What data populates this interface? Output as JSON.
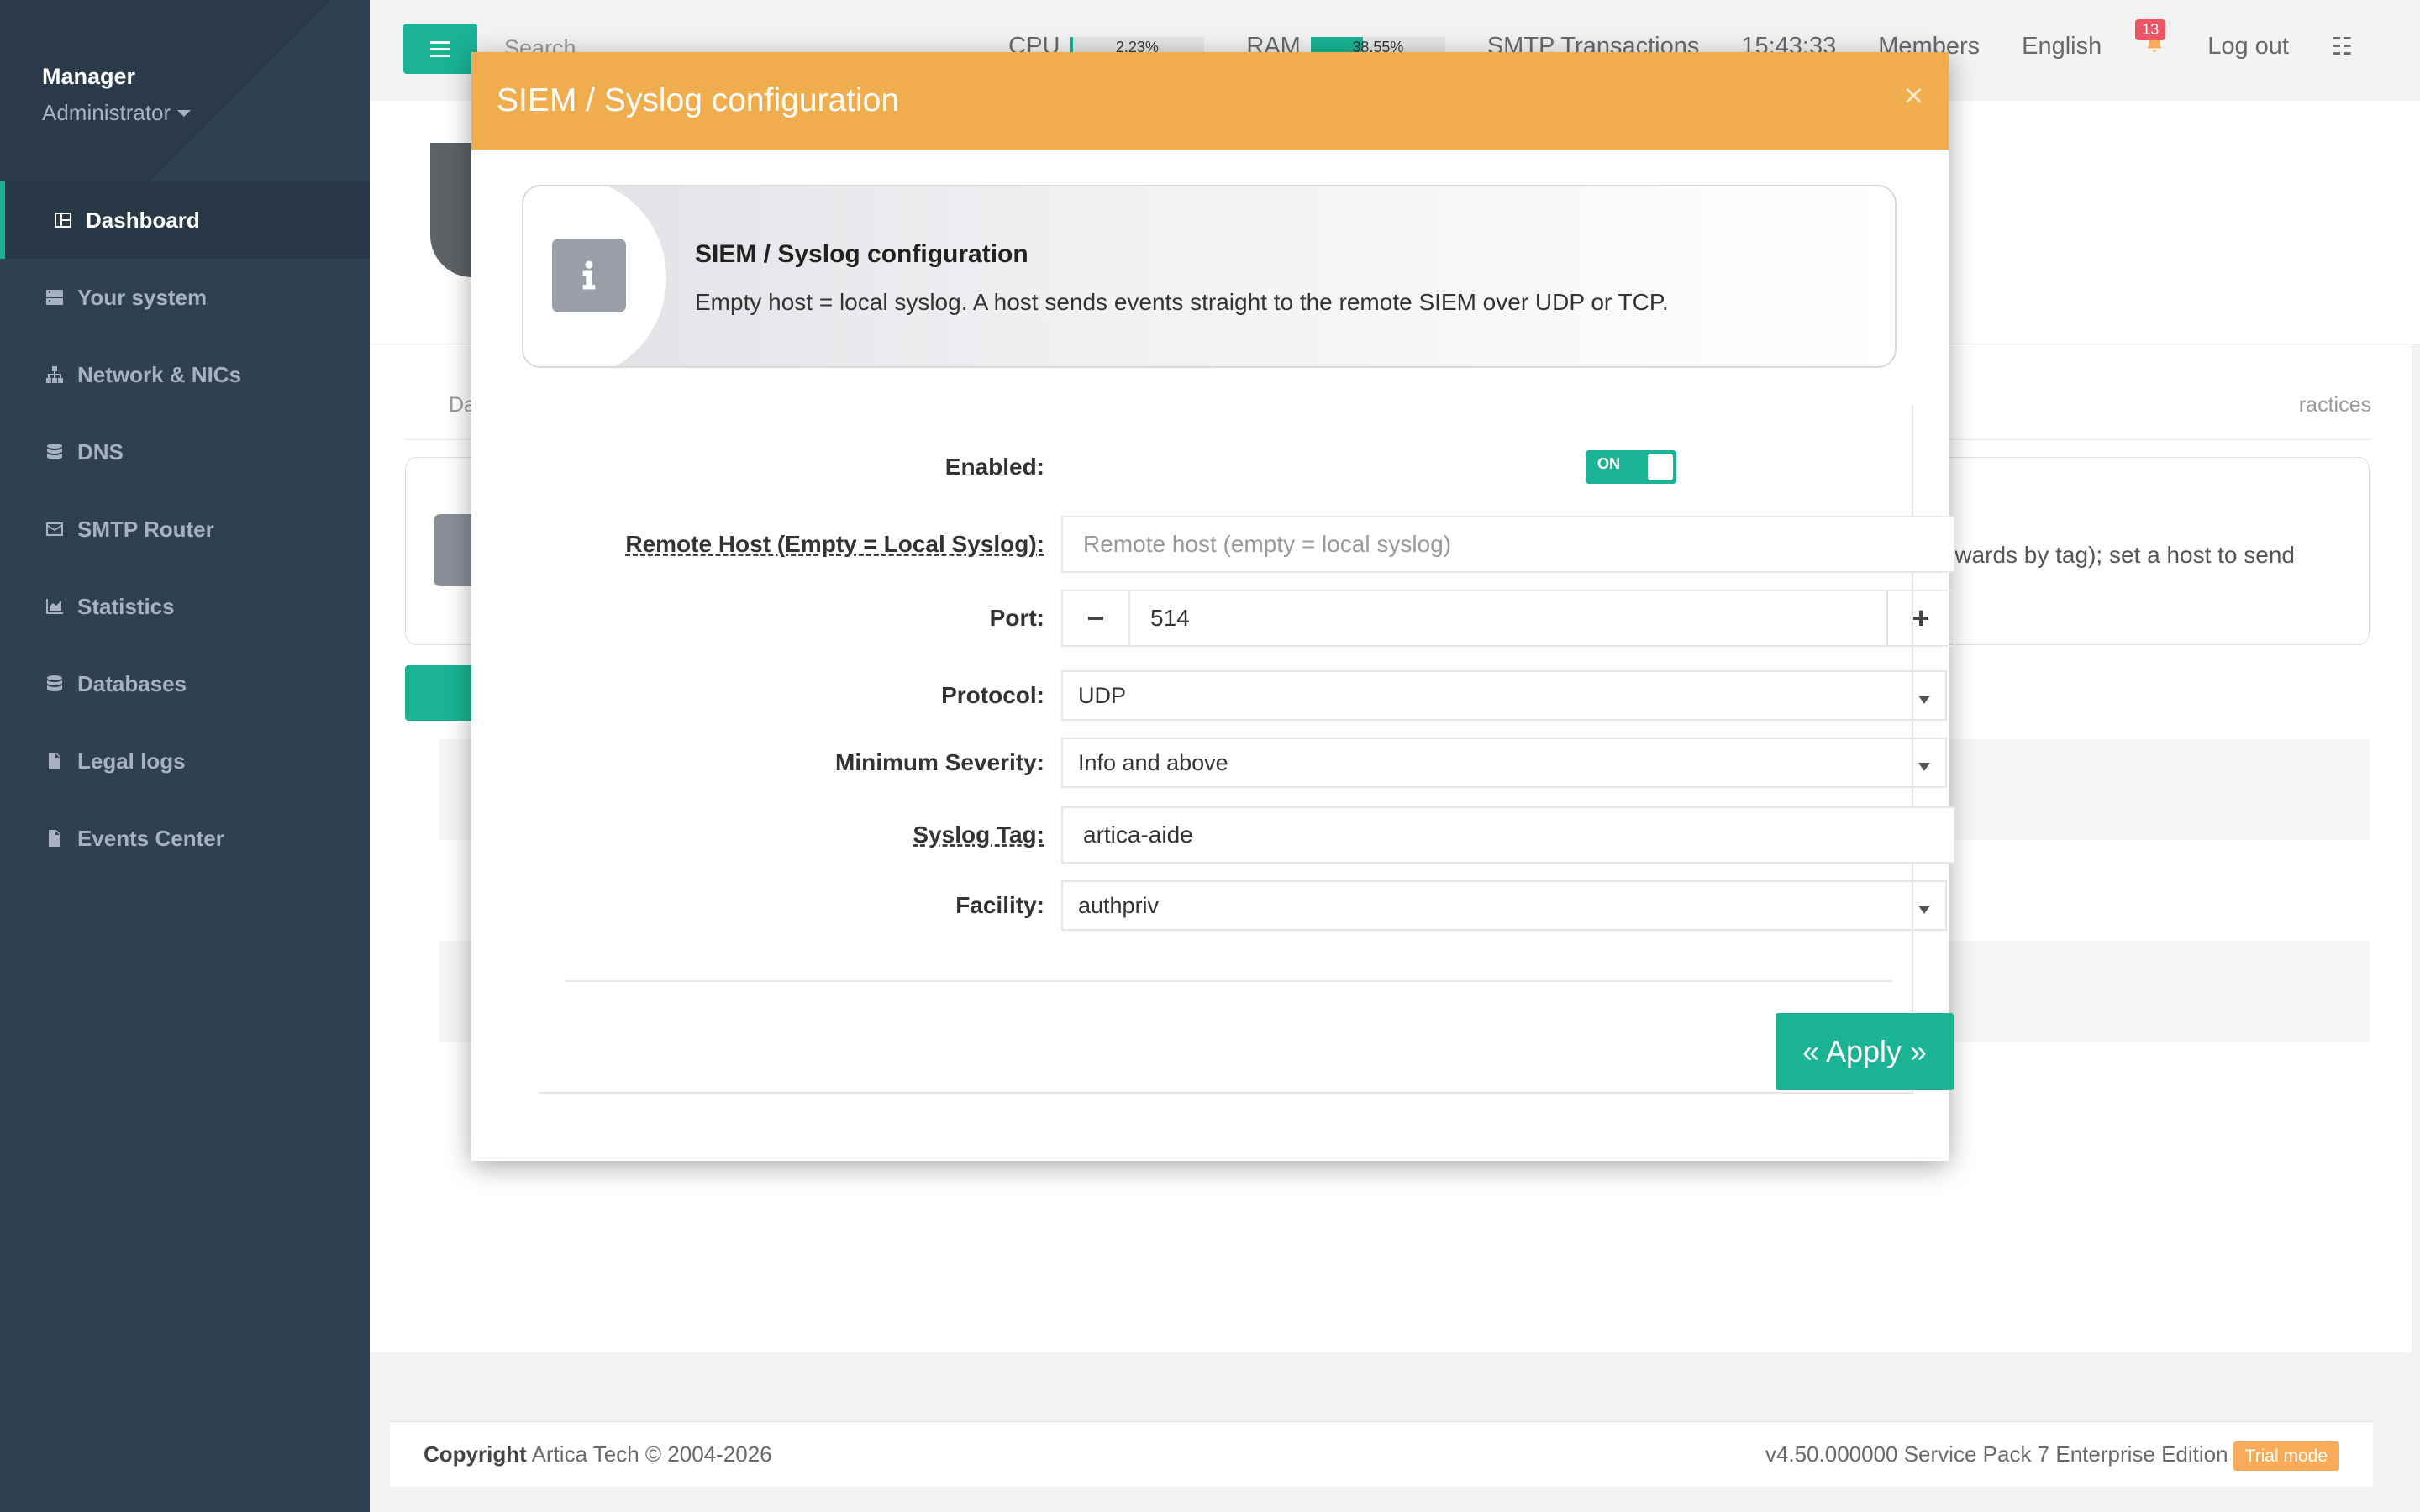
{
  "sidebar": {
    "profile_name": "Manager",
    "profile_role": "Administrator",
    "items": [
      {
        "label": "Dashboard",
        "icon": "dashboard-icon"
      },
      {
        "label": "Your system",
        "icon": "server-icon"
      },
      {
        "label": "Network & NICs",
        "icon": "sitemap-icon"
      },
      {
        "label": "DNS",
        "icon": "database-icon"
      },
      {
        "label": "SMTP Router",
        "icon": "envelope-icon"
      },
      {
        "label": "Statistics",
        "icon": "chart-area-icon"
      },
      {
        "label": "Databases",
        "icon": "database-icon"
      },
      {
        "label": "Legal logs",
        "icon": "file-icon"
      },
      {
        "label": "Events Center",
        "icon": "file-text-icon"
      }
    ]
  },
  "topbar": {
    "search": "Search",
    "cpu_label": "CPU",
    "cpu_value": "2.23%",
    "cpu_fraction": 0.0223,
    "ram_label": "RAM",
    "ram_value": "38.55%",
    "ram_fraction": 0.3855,
    "smtp": "SMTP Transactions",
    "time": "15:43:33",
    "members": "Members",
    "language": "English",
    "notifications": "13",
    "logout": "Log out"
  },
  "background": {
    "tab_left": "Da",
    "tab_right": "ractices",
    "panel_text": "orwards by tag); set a host to send"
  },
  "modal": {
    "title": "SIEM / Syslog configuration",
    "info_title": "SIEM / Syslog configuration",
    "info_text": "Empty host = local syslog. A host sends events straight to the remote SIEM over UDP or TCP.",
    "fields": {
      "enabled_label": "Enabled:",
      "enabled_value": "ON",
      "host_label": "Remote Host (Empty = Local Syslog):",
      "host_placeholder": "Remote host (empty = local syslog)",
      "port_label": "Port:",
      "port_value": "514",
      "protocol_label": "Protocol:",
      "protocol_value": "UDP",
      "severity_label": "Minimum Severity:",
      "severity_value": "Info and above",
      "tag_label": "Syslog Tag:",
      "tag_value": "artica-aide",
      "facility_label": "Facility:",
      "facility_value": "authpriv"
    },
    "apply": "« Apply »"
  },
  "footer": {
    "copyright_bold": "Copyright",
    "copyright_rest": "Artica Tech © 2004-2026",
    "version": "v4.50.000000 Service Pack 7 Enterprise Edition",
    "trial": "Trial mode"
  },
  "colors": {
    "accent": "#1ab394",
    "modal_header": "#f0ad4e",
    "sidebar": "#2f4050",
    "badge": "#ed5565"
  }
}
